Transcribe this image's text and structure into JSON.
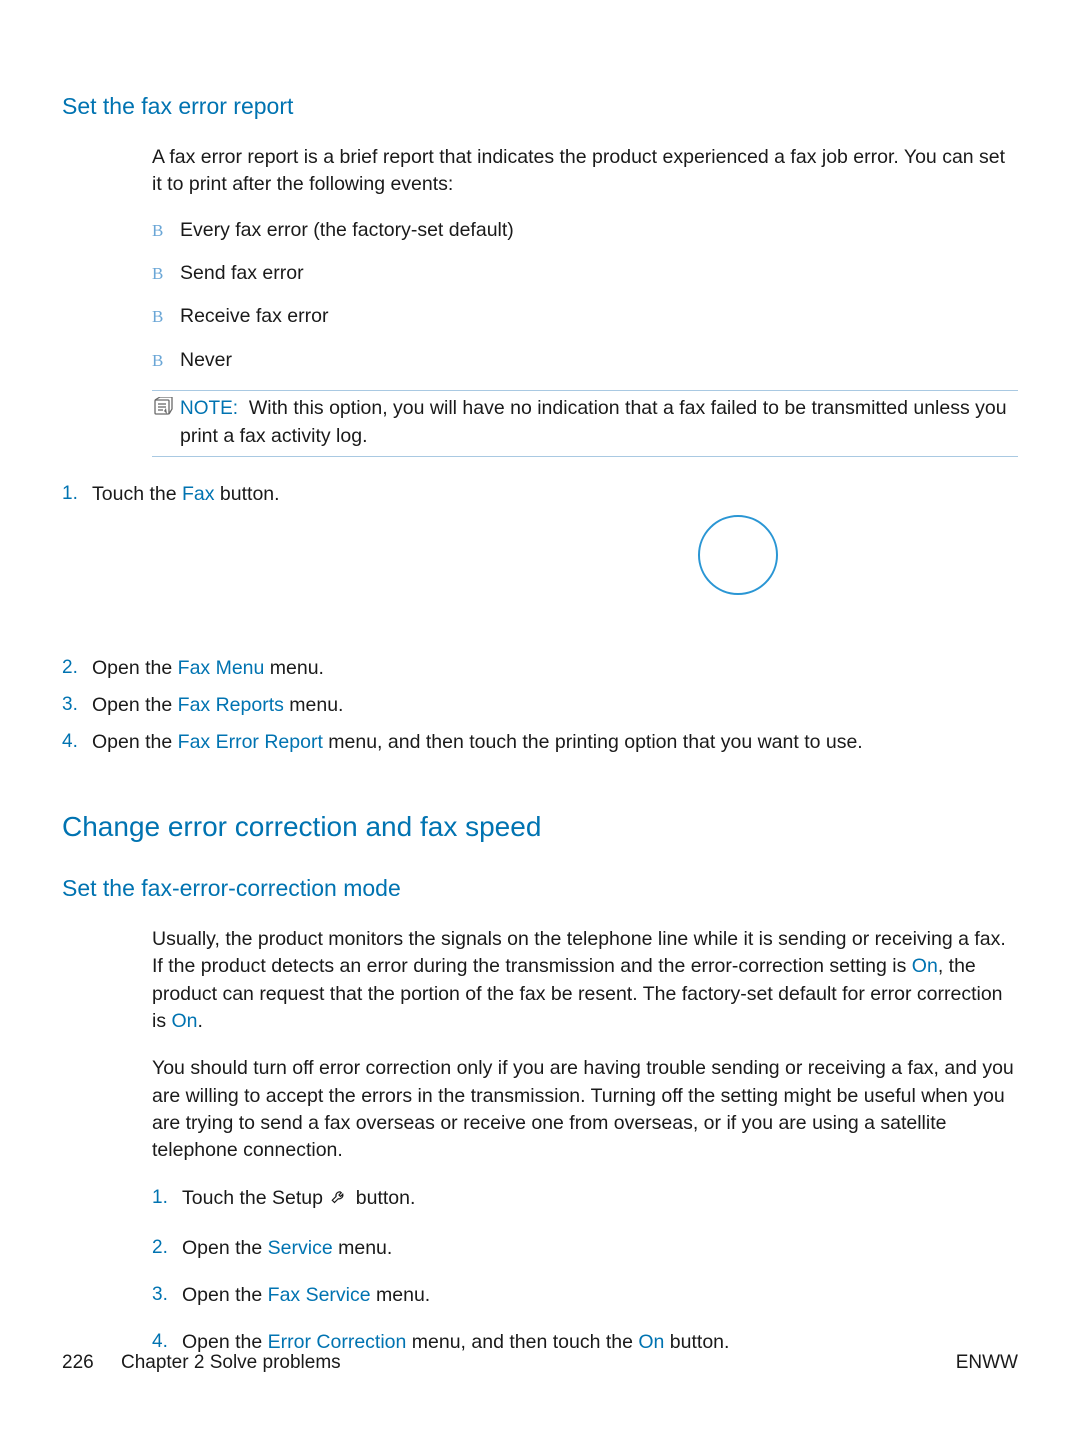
{
  "section1": {
    "heading": "Set the fax error report",
    "intro": "A fax error report is a brief report that indicates the product experienced a fax job error. You can set it to print after the following events:",
    "bullets": [
      "Every fax error (the factory-set default)",
      "Send fax error",
      "Receive fax error",
      "Never"
    ],
    "note_label": "NOTE:",
    "note_text": "With this option, you will have no indication that a fax failed to be transmitted unless you print a fax activity log.",
    "step1": {
      "num": "1.",
      "pre": "Touch the ",
      "ui": "Fax",
      "post": " button."
    },
    "steps_rest": [
      {
        "num": "2.",
        "pre": "Open the ",
        "ui": "Fax Menu",
        "post": " menu."
      },
      {
        "num": "3.",
        "pre": "Open the ",
        "ui": "Fax Reports",
        "post": " menu."
      },
      {
        "num": "4.",
        "pre": "Open the ",
        "ui": "Fax Error Report",
        "post": " menu, and then touch the printing option that you want to use."
      }
    ]
  },
  "section2": {
    "heading": "Change error correction and fax speed",
    "sub_heading": "Set the fax-error-correction mode",
    "p1_pre": "Usually, the product monitors the signals on the telephone line while it is sending or receiving a fax. If the product detects an error during the transmission and the error-correction setting is ",
    "p1_ui1": "On",
    "p1_mid": ", the product can request that the portion of the fax be resent. The factory-set default for error correction is ",
    "p1_ui2": "On",
    "p1_post": ".",
    "p2": "You should turn off error correction only if you are having trouble sending or receiving a fax, and you are willing to accept the errors in the transmission. Turning off the setting might be useful when you are trying to send a fax overseas or receive one from overseas, or if you are using a satellite telephone connection.",
    "steps": [
      {
        "num": "1.",
        "parts": [
          {
            "t": "Touch the Setup "
          },
          {
            "icon": "wrench"
          },
          {
            "t": " button."
          }
        ]
      },
      {
        "num": "2.",
        "parts": [
          {
            "t": "Open the "
          },
          {
            "ui": "Service"
          },
          {
            "t": " menu."
          }
        ]
      },
      {
        "num": "3.",
        "parts": [
          {
            "t": "Open the "
          },
          {
            "ui": "Fax Service"
          },
          {
            "t": " menu."
          }
        ]
      },
      {
        "num": "4.",
        "parts": [
          {
            "t": "Open the "
          },
          {
            "ui": "Error Correction"
          },
          {
            "t": " menu, and then touch the "
          },
          {
            "ui": "On"
          },
          {
            "t": " button."
          }
        ]
      }
    ]
  },
  "footer": {
    "page_num": "226",
    "chapter": "Chapter 2   Solve problems",
    "lang": "ENWW"
  }
}
